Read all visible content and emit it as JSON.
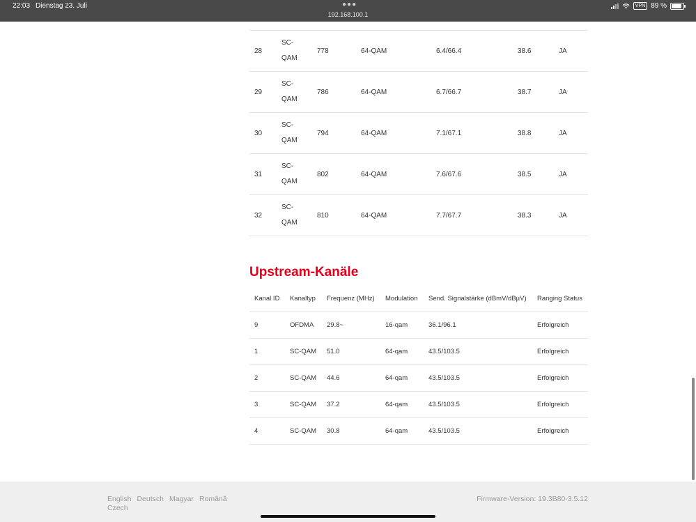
{
  "status_bar": {
    "time": "22:03",
    "date": "Dienstag 23. Juli",
    "url": "192.168.100.1",
    "vpn": "VPN",
    "battery": "89 %",
    "battery_level": 0.89
  },
  "downstream": {
    "rows": [
      {
        "id": "28",
        "type_line1": "SC-",
        "type_line2": "QAM",
        "freq": "778",
        "mod": "64-QAM",
        "power": "6.4/66.4",
        "snr": "38.6",
        "locked": "JA"
      },
      {
        "id": "29",
        "type_line1": "SC-",
        "type_line2": "QAM",
        "freq": "786",
        "mod": "64-QAM",
        "power": "6.7/66.7",
        "snr": "38.7",
        "locked": "JA"
      },
      {
        "id": "30",
        "type_line1": "SC-",
        "type_line2": "QAM",
        "freq": "794",
        "mod": "64-QAM",
        "power": "7.1/67.1",
        "snr": "38.8",
        "locked": "JA"
      },
      {
        "id": "31",
        "type_line1": "SC-",
        "type_line2": "QAM",
        "freq": "802",
        "mod": "64-QAM",
        "power": "7.6/67.6",
        "snr": "38.5",
        "locked": "JA"
      },
      {
        "id": "32",
        "type_line1": "SC-",
        "type_line2": "QAM",
        "freq": "810",
        "mod": "64-QAM",
        "power": "7.7/67.7",
        "snr": "38.3",
        "locked": "JA"
      }
    ]
  },
  "upstream": {
    "title": "Upstream-Kanäle",
    "headers": {
      "id": "Kanal ID",
      "type": "Kanaltyp",
      "freq": "Frequenz (MHz)",
      "mod": "Modulation",
      "power": "Send. Signalstärke (dBmV/dBµV)",
      "ranging": "Ranging Status"
    },
    "rows": [
      {
        "id": "9",
        "type": "OFDMA",
        "freq": "29.8~",
        "mod": "16-qam",
        "power": "36.1/96.1",
        "ranging": "Erfolgreich"
      },
      {
        "id": "1",
        "type": "SC-QAM",
        "freq": "51.0",
        "mod": "64-qam",
        "power": "43.5/103.5",
        "ranging": "Erfolgreich"
      },
      {
        "id": "2",
        "type": "SC-QAM",
        "freq": "44.6",
        "mod": "64-qam",
        "power": "43.5/103.5",
        "ranging": "Erfolgreich"
      },
      {
        "id": "3",
        "type": "SC-QAM",
        "freq": "37.2",
        "mod": "64-qam",
        "power": "43.5/103.5",
        "ranging": "Erfolgreich"
      },
      {
        "id": "4",
        "type": "SC-QAM",
        "freq": "30.8",
        "mod": "64-qam",
        "power": "43.5/103.5",
        "ranging": "Erfolgreich"
      }
    ]
  },
  "footer": {
    "languages": [
      "English",
      "Deutsch",
      "Magyar",
      "Română",
      "Czech"
    ],
    "firmware": "Firmware-Version: 19.3B80-3.5.12"
  },
  "colors": {
    "accent": "#e2001a",
    "status_bar_bg": "#494949",
    "footer_bg": "#efefef"
  }
}
